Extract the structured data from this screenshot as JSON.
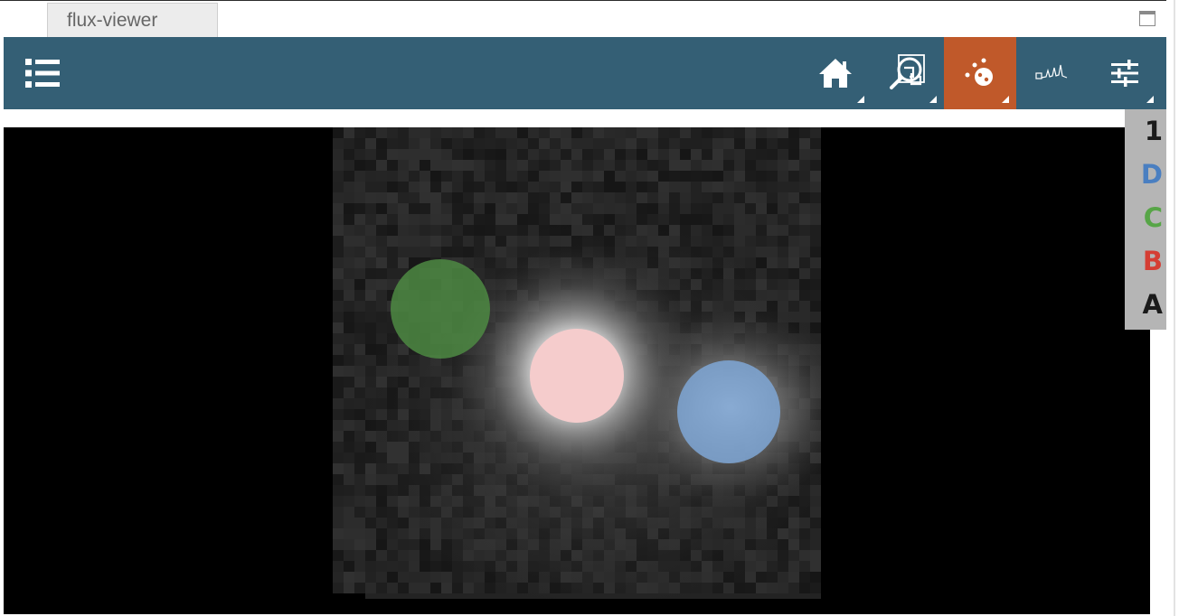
{
  "tab": {
    "title": "flux-viewer"
  },
  "toolbar": {
    "tools": [
      {
        "name": "home",
        "icon": "home-icon",
        "active": false
      },
      {
        "name": "zoom-link",
        "icon": "magnify-link-icon",
        "active": false
      },
      {
        "name": "apertures",
        "icon": "aperture-dots-icon",
        "active": true
      },
      {
        "name": "spectrum",
        "icon": "spectrum-icon",
        "active": false
      },
      {
        "name": "layer-settings",
        "icon": "sliders-icon",
        "active": false
      }
    ]
  },
  "legend": {
    "items": [
      {
        "label": "1",
        "color": "#1a1a1a"
      },
      {
        "label": "D",
        "color": "#4a7fc1"
      },
      {
        "label": "C",
        "color": "#57a547"
      },
      {
        "label": "B",
        "color": "#d53d33"
      },
      {
        "label": "A",
        "color": "#1a1a1a"
      }
    ]
  },
  "apertures": [
    {
      "name": "C",
      "color": "#4e8a43"
    },
    {
      "name": "B",
      "color": "#f5cccc"
    },
    {
      "name": "D",
      "color": "#7fa7d6"
    }
  ],
  "colors": {
    "toolbar": "#345f75",
    "active_tool": "#c0592a",
    "legend_bg": "#b5b5b5",
    "viewer_bg": "#000000"
  }
}
